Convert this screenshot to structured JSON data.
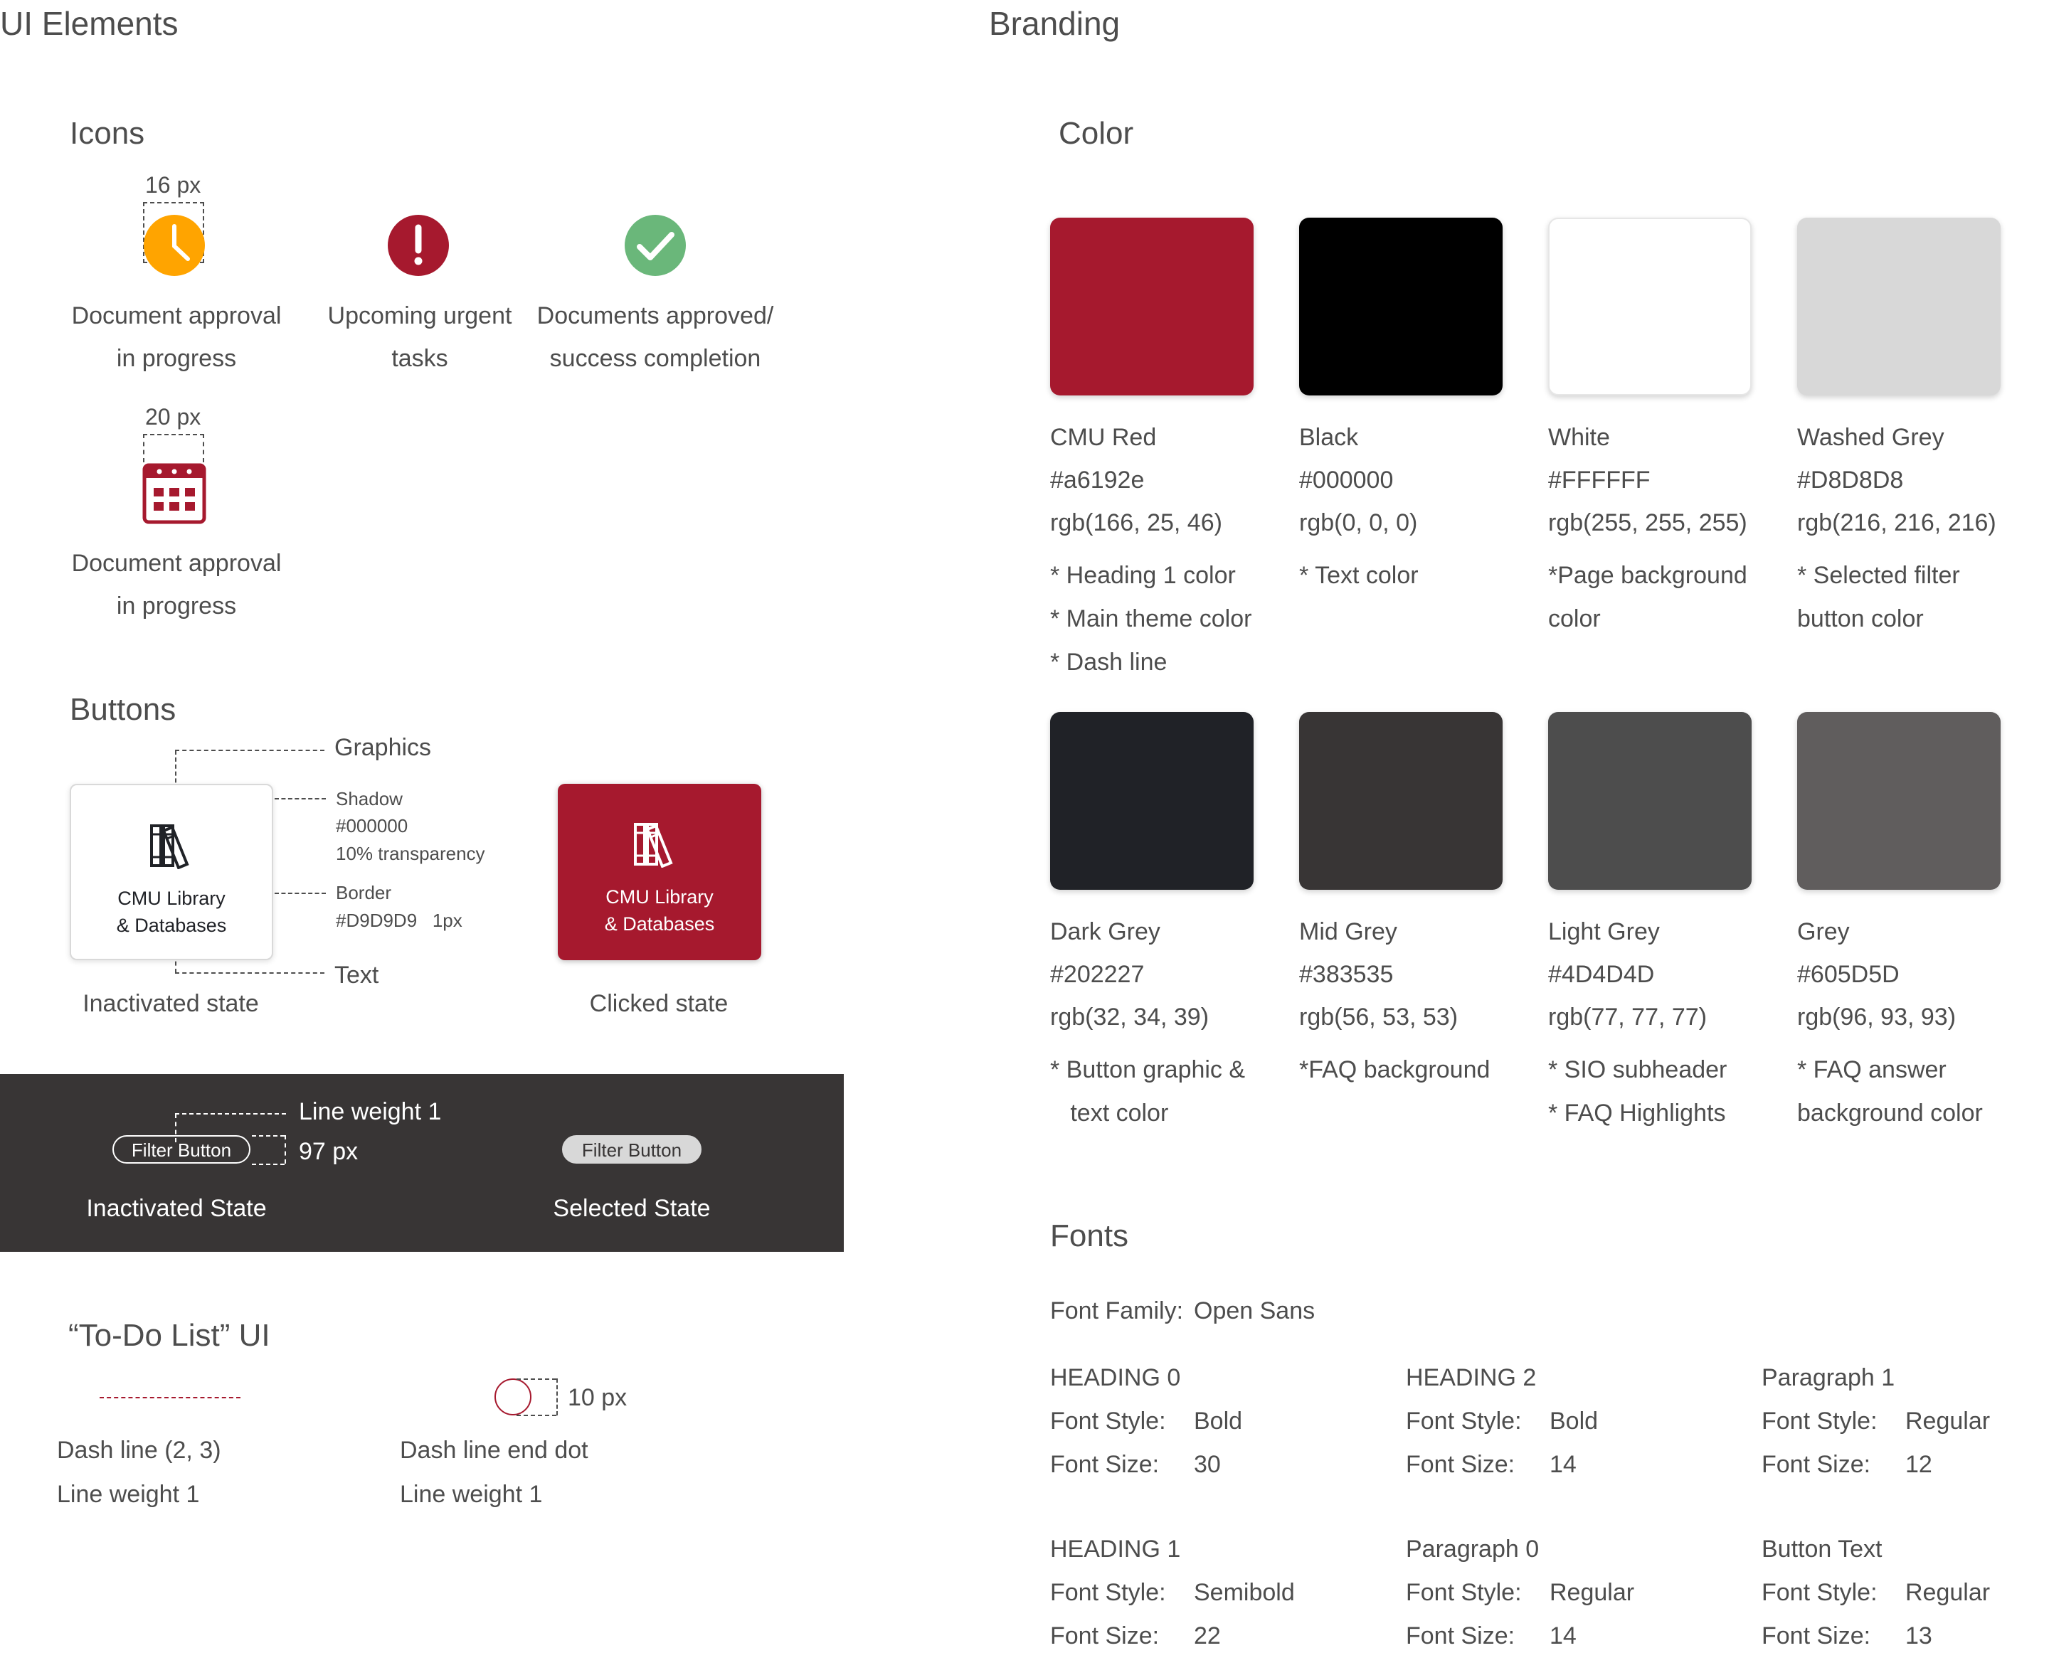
{
  "ui_elements": {
    "title": "UI Elements",
    "icons": {
      "title": "Icons",
      "size_16": "16 px",
      "size_20": "20 px",
      "items": [
        {
          "line1": "Document approval",
          "line2": "in progress",
          "icon": "clock-icon",
          "color": "#ffa400"
        },
        {
          "line1": "Upcoming urgent",
          "line2": "tasks",
          "icon": "exclamation-icon",
          "color": "#a6192e"
        },
        {
          "line1": "Documents approved/",
          "line2": "success completion",
          "icon": "check-icon",
          "color": "#6ab77a"
        },
        {
          "line1": "Document approval",
          "line2": "in progress",
          "icon": "calendar-icon",
          "color": "#a6192e"
        }
      ]
    },
    "buttons": {
      "title": "Buttons",
      "label_line1": "CMU Library",
      "label_line2": "& Databases",
      "annotations": {
        "graphics": "Graphics",
        "shadow": "Shadow",
        "shadow_color": "#000000",
        "shadow_transparency": "10% transparency",
        "border": "Border",
        "border_value": "#D9D9D9   1px",
        "text": "Text"
      },
      "inactive_state": "Inactivated state",
      "clicked_state": "Clicked state"
    },
    "filter": {
      "line_weight": "Line weight 1",
      "width": "97 px",
      "button_label": "Filter Button",
      "inactive_state": "Inactivated State",
      "selected_state": "Selected State"
    },
    "todo": {
      "title": "“To-Do List” UI",
      "dot_size": "10 px",
      "dash_line": "Dash line (2, 3)",
      "dash_line_weight": "Line weight 1",
      "end_dot": "Dash line end dot",
      "end_dot_weight": "Line weight 1"
    }
  },
  "branding": {
    "title": "Branding",
    "color_title": "Color",
    "colors": [
      {
        "name": "CMU Red",
        "hex": "#a6192e",
        "rgb": "rgb(166, 25, 46)",
        "notes": [
          "* Heading 1 color",
          "* Main theme color",
          "* Dash line"
        ]
      },
      {
        "name": "Black",
        "hex": "#000000",
        "rgb": "rgb(0, 0, 0)",
        "notes": [
          "* Text color"
        ]
      },
      {
        "name": "White",
        "hex": "#FFFFFF",
        "rgb": "rgb(255, 255, 255)",
        "notes": [
          "*Page background",
          "color"
        ]
      },
      {
        "name": "Washed Grey",
        "hex": "#D8D8D8",
        "rgb": "rgb(216, 216, 216)",
        "notes": [
          "* Selected filter",
          "button color"
        ]
      },
      {
        "name": "Dark Grey",
        "hex": "#202227",
        "rgb": "rgb(32, 34, 39)",
        "notes": [
          "* Button graphic &",
          "   text color"
        ]
      },
      {
        "name": "Mid Grey",
        "hex": "#383535",
        "rgb": "rgb(56, 53, 53)",
        "notes": [
          "*FAQ background"
        ]
      },
      {
        "name": "Light Grey",
        "hex": "#4D4D4D",
        "rgb": "rgb(77, 77, 77)",
        "notes": [
          "* SIO subheader",
          "* FAQ Highlights"
        ]
      },
      {
        "name": "Grey",
        "hex": "#605D5D",
        "rgb": "rgb(96, 93, 93)",
        "notes": [
          "* FAQ answer",
          "background color"
        ]
      }
    ],
    "fonts": {
      "title": "Fonts",
      "family_label": "Font Family:",
      "family_value": "Open Sans",
      "style_label": "Font Style:",
      "size_label": "Font Size:",
      "items": [
        {
          "name": "HEADING 0",
          "style": "Bold",
          "size": "30"
        },
        {
          "name": "HEADING 2",
          "style": "Bold",
          "size": "14"
        },
        {
          "name": "Paragraph 1",
          "style": "Regular",
          "size": "12"
        },
        {
          "name": "HEADING 1",
          "style": "Semibold",
          "size": "22"
        },
        {
          "name": "Paragraph 0",
          "style": "Regular",
          "size": "14"
        },
        {
          "name": "Button Text",
          "style": "Regular",
          "size": "13"
        }
      ]
    }
  }
}
